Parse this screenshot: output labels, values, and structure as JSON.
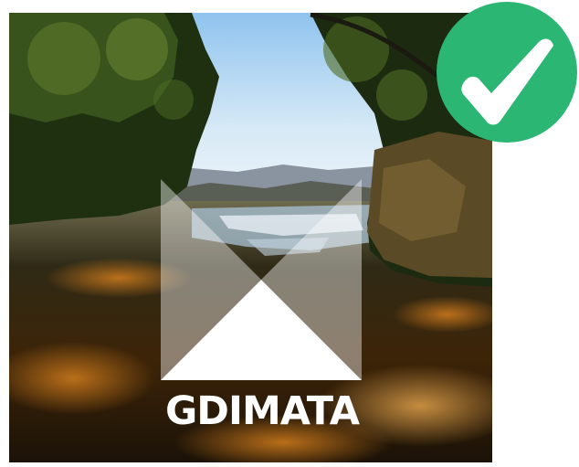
{
  "brand": {
    "name": "GDIMATA"
  },
  "badge": {
    "icon": "checkmark-icon",
    "state": "approved",
    "color": "#2bb673"
  },
  "image": {
    "subject": "waterfall-river-photo"
  }
}
